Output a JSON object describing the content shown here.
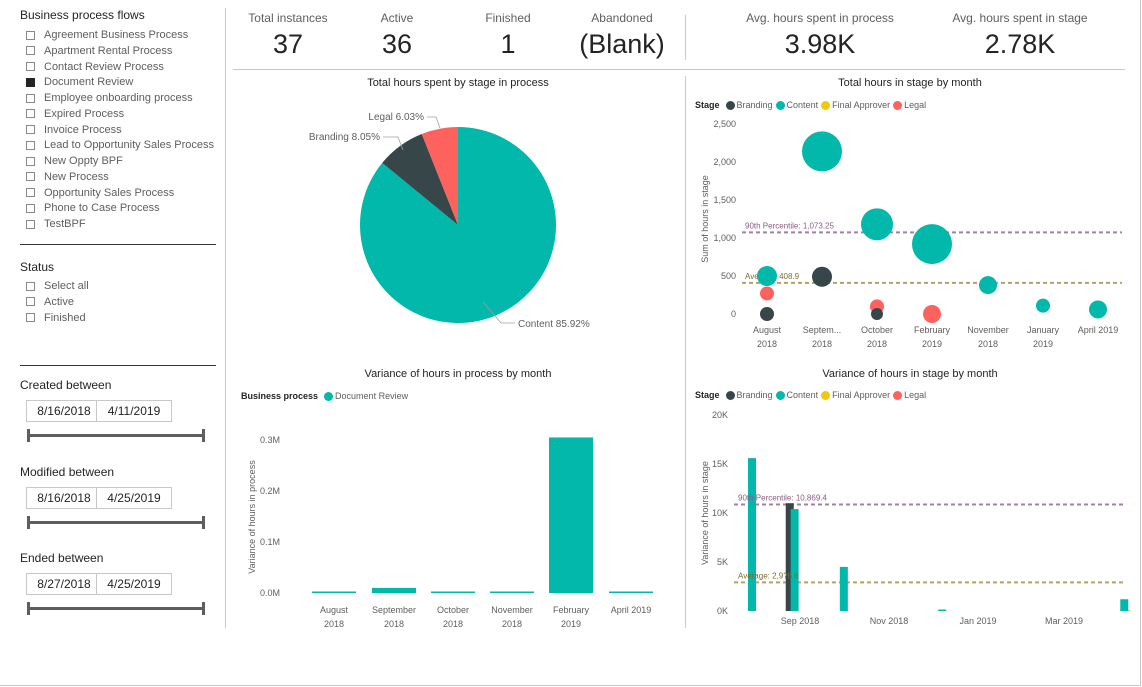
{
  "slicers": {
    "bpf": {
      "title": "Business process flows",
      "items": [
        {
          "label": "Agreement Business Process",
          "checked": false
        },
        {
          "label": "Apartment Rental Process",
          "checked": false
        },
        {
          "label": "Contact Review Process",
          "checked": false
        },
        {
          "label": "Document Review",
          "checked": true
        },
        {
          "label": "Employee onboarding process",
          "checked": false
        },
        {
          "label": "Expired Process",
          "checked": false
        },
        {
          "label": "Invoice Process",
          "checked": false
        },
        {
          "label": "Lead to Opportunity Sales Process",
          "checked": false
        },
        {
          "label": "New Oppty BPF",
          "checked": false
        },
        {
          "label": "New Process",
          "checked": false
        },
        {
          "label": "Opportunity Sales Process",
          "checked": false
        },
        {
          "label": "Phone to Case Process",
          "checked": false
        },
        {
          "label": "TestBPF",
          "checked": false
        }
      ]
    },
    "status": {
      "title": "Status",
      "items": [
        {
          "label": "Select all",
          "checked": false
        },
        {
          "label": "Active",
          "checked": false
        },
        {
          "label": "Finished",
          "checked": false
        }
      ]
    },
    "created": {
      "title": "Created between",
      "start": "8/16/2018",
      "end": "4/11/2019"
    },
    "modified": {
      "title": "Modified between",
      "start": "8/16/2018",
      "end": "4/25/2019"
    },
    "ended": {
      "title": "Ended between",
      "start": "8/27/2018",
      "end": "4/25/2019"
    }
  },
  "kpis": [
    {
      "label": "Total instances",
      "value": "37"
    },
    {
      "label": "Active",
      "value": "36"
    },
    {
      "label": "Finished",
      "value": "1"
    },
    {
      "label": "Abandoned",
      "value": "(Blank)"
    },
    {
      "label": "Avg. hours spent in process",
      "value": "3.98K"
    },
    {
      "label": "Avg. hours spent in stage",
      "value": "2.78K"
    }
  ],
  "colors": {
    "branding": "#374649",
    "content": "#01B8AA",
    "final_approver": "#F2C80F",
    "legal": "#FD625E",
    "percentile_line": "#a47fa8",
    "average_line": "#b3a36a"
  },
  "charts": {
    "pie": {
      "title": "Total hours spent by stage in process"
    },
    "scatter": {
      "title": "Total hours in stage by month",
      "legend_title": "Stage",
      "y_axis": "Sum of hours in stage",
      "p90_label": "90th Percentile: 1,073.25",
      "avg_label": "Average: 408.9"
    },
    "bar": {
      "title": "Variance of hours in process by month",
      "legend_title": "Business process",
      "legend_item": "Document Review",
      "y_axis": "Variance of hours in process"
    },
    "stagebar": {
      "title": "Variance of hours in stage by month",
      "legend_title": "Stage",
      "y_axis": "Variance of hours in stage",
      "p90_label": "90th Percentile: 10,869.4",
      "avg_label": "Average: 2,9?6.6"
    },
    "stage_names": [
      "Branding",
      "Content",
      "Final Approver",
      "Legal"
    ]
  },
  "chart_data": [
    {
      "type": "pie",
      "title": "Total hours spent by stage in process",
      "slices": [
        {
          "name": "Content",
          "percent": 85.92,
          "label": "Content 85.92%"
        },
        {
          "name": "Branding",
          "percent": 8.05,
          "label": "Branding 8.05%"
        },
        {
          "name": "Legal",
          "percent": 6.03,
          "label": "Legal 6.03%"
        }
      ]
    },
    {
      "type": "scatter",
      "title": "Total hours in stage by month",
      "ylabel": "Sum of hours in stage",
      "ylim": [
        0,
        2500
      ],
      "yticks": [
        "0",
        "500",
        "1,000",
        "1,500",
        "2,000",
        "2,500"
      ],
      "categories": [
        [
          "August",
          "2018"
        ],
        [
          "Septem...",
          "2018"
        ],
        [
          "October",
          "2018"
        ],
        [
          "February",
          "2019"
        ],
        [
          "November",
          "2018"
        ],
        [
          "January",
          "2019"
        ],
        [
          "April 2019",
          ""
        ]
      ],
      "reference_lines": [
        {
          "label": "90th Percentile: 1,073.25",
          "value": 1073.25
        },
        {
          "label": "Average: 408.9",
          "value": 408.9
        }
      ],
      "points": [
        {
          "series": "Content",
          "cat": 0,
          "y": 500,
          "size": 10
        },
        {
          "series": "Legal",
          "cat": 0,
          "y": 270,
          "size": 7
        },
        {
          "series": "Branding",
          "cat": 0,
          "y": 0,
          "size": 7
        },
        {
          "series": "Content",
          "cat": 1,
          "y": 2140,
          "size": 20
        },
        {
          "series": "Branding",
          "cat": 1,
          "y": 490,
          "size": 10
        },
        {
          "series": "Content",
          "cat": 2,
          "y": 1180,
          "size": 16
        },
        {
          "series": "Legal",
          "cat": 2,
          "y": 100,
          "size": 7
        },
        {
          "series": "Branding",
          "cat": 2,
          "y": 0,
          "size": 6
        },
        {
          "series": "Content",
          "cat": 3,
          "y": 920,
          "size": 20
        },
        {
          "series": "Legal",
          "cat": 3,
          "y": 0,
          "size": 9
        },
        {
          "series": "Content",
          "cat": 4,
          "y": 380,
          "size": 9
        },
        {
          "series": "Content",
          "cat": 5,
          "y": 110,
          "size": 7
        },
        {
          "series": "Content",
          "cat": 6,
          "y": 60,
          "size": 9
        }
      ]
    },
    {
      "type": "bar",
      "title": "Variance of hours in process by month",
      "ylabel": "Variance of hours in process",
      "ylim": [
        0,
        0.33
      ],
      "yticks": [
        "0.0M",
        "0.1M",
        "0.2M",
        "0.3M"
      ],
      "categories": [
        [
          "August",
          "2018"
        ],
        [
          "September",
          "2018"
        ],
        [
          "October",
          "2018"
        ],
        [
          "November",
          "2018"
        ],
        [
          "February",
          "2019"
        ],
        [
          "April 2019",
          ""
        ]
      ],
      "series": [
        {
          "name": "Document Review",
          "values": [
            0.002,
            0.01,
            0.002,
            0.002,
            0.305,
            0.002
          ]
        }
      ]
    },
    {
      "type": "bar",
      "title": "Variance of hours in stage by month",
      "ylabel": "Variance of hours in stage",
      "ylim": [
        0,
        20000
      ],
      "yticks": [
        "0K",
        "5K",
        "10K",
        "15K",
        "20K"
      ],
      "xticks": [
        "Sep 2018",
        "Nov 2018",
        "Jan 2019",
        "Mar 2019"
      ],
      "reference_lines": [
        {
          "label": "90th Percentile: 10,869.4",
          "value": 10869.4
        },
        {
          "label": "Average: 2,9?6.6",
          "value": 2920
        }
      ],
      "bars": [
        {
          "series": "Content",
          "day": 0,
          "value": 15600
        },
        {
          "series": "Branding",
          "day": 23,
          "value": 11000
        },
        {
          "series": "Content",
          "day": 26,
          "value": 10400
        },
        {
          "series": "Content",
          "day": 56,
          "value": 4500
        },
        {
          "series": "Content",
          "day": 116,
          "value": 150
        },
        {
          "series": "Content",
          "day": 227,
          "value": 1200
        },
        {
          "series": "Final Approver",
          "day": 232,
          "value": 100
        },
        {
          "series": "Legal",
          "day": 236,
          "value": 100
        },
        {
          "series": "Content",
          "day": 268,
          "value": 150
        }
      ]
    }
  ]
}
